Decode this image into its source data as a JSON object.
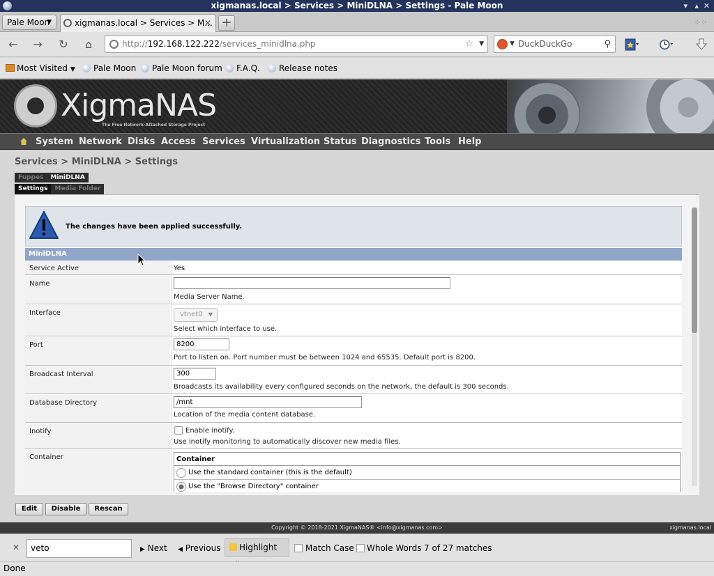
{
  "window": {
    "title": "xigmanas.local > Services > MiniDLNA > Settings - Pale Moon",
    "controls": [
      "▾",
      "▴",
      "✕"
    ]
  },
  "browser": {
    "app_menu": "Pale Moon",
    "tab_title": "xigmanas.local > Services > M...",
    "url_scheme": "http://",
    "url_host": "192.168.122.222",
    "url_path": "/services_minidlna.php",
    "search_engine": "DuckDuckGo",
    "bookmarks": [
      "Most Visited",
      "Pale Moon",
      "Pale Moon forum",
      "F.A.Q.",
      "Release notes"
    ]
  },
  "header": {
    "logo_text": "XigmaNAS",
    "logo_tagline": "The Free Network-Attached Storage Project"
  },
  "nav": {
    "items": [
      "System",
      "Network",
      "Disks",
      "Access",
      "Services",
      "Virtualization",
      "Status",
      "Diagnostics",
      "Tools",
      "Help"
    ]
  },
  "page": {
    "breadcrumb": "Services > MiniDLNA > Settings",
    "tabs_level1": [
      "Fuppes",
      "MiniDLNA"
    ],
    "tabs_level2": [
      "Settings",
      "Media Folder"
    ],
    "message": "The changes have been applied successfully.",
    "section_title": "MiniDLNA",
    "fields": {
      "service_active": {
        "label": "Service Active",
        "value": "Yes"
      },
      "name": {
        "label": "Name",
        "value": "",
        "desc": "Media Server Name."
      },
      "interface": {
        "label": "Interface",
        "value": "vtnet0",
        "desc": "Select which interface to use."
      },
      "port": {
        "label": "Port",
        "value": "8200",
        "desc": "Port to listen on. Port number must be between 1024 and 65535. Default port is 8200."
      },
      "broadcast": {
        "label": "Broadcast Interval",
        "value": "300",
        "desc": "Broadcasts its availability every configured seconds on the network, the default is 300 seconds."
      },
      "database": {
        "label": "Database Directory",
        "value": "/mnt",
        "desc": "Location of the media content database."
      },
      "inotify": {
        "label": "Inotify",
        "checkbox_label": "Enable inotify.",
        "desc": "Use inotify monitoring to automatically discover new media files."
      },
      "container": {
        "label": "Container",
        "table_title": "Container",
        "options": [
          "Use the standard container (this is the default)",
          "Use the \"Browse Directory\" container"
        ]
      }
    },
    "buttons": [
      "Edit",
      "Disable",
      "Rescan"
    ],
    "footer_copyright": "Copyright © 2018-2021 XigmaNAS® <info@xigmanas.com>",
    "footer_host": "xigmanas.local"
  },
  "findbar": {
    "query": "veto",
    "next": "Next",
    "previous": "Previous",
    "highlight_all": "Highlight All",
    "match_case": "Match Case",
    "whole_words": "Whole Words",
    "result": "7 of 27 matches"
  },
  "status": "Done"
}
